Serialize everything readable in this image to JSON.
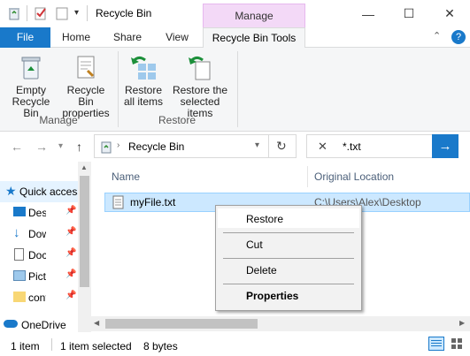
{
  "window": {
    "title": "Recycle Bin",
    "context_tab": "Manage",
    "controls": {
      "minimize": "—",
      "maximize": "☐",
      "close": "✕"
    }
  },
  "ribbon_tabs": {
    "file": "File",
    "home": "Home",
    "share": "Share",
    "view": "View",
    "tools": "Recycle Bin Tools"
  },
  "ribbon": {
    "manage": {
      "label": "Manage",
      "empty_line1": "Empty",
      "empty_line2": "Recycle Bin",
      "props_line1": "Recycle Bin",
      "props_line2": "properties"
    },
    "restore": {
      "label": "Restore",
      "all_line1": "Restore",
      "all_line2": "all items",
      "sel_line1": "Restore the",
      "sel_line2": "selected items"
    }
  },
  "address": {
    "path": "Recycle Bin",
    "search_value": "*.txt"
  },
  "nav_pane": {
    "items": [
      {
        "label": "Quick access",
        "icon": "star-icon"
      },
      {
        "label": "Desktop",
        "icon": "desktop-icon"
      },
      {
        "label": "Downloads",
        "icon": "download-icon"
      },
      {
        "label": "Documents",
        "icon": "document-icon"
      },
      {
        "label": "Pictures",
        "icon": "picture-icon"
      },
      {
        "label": "content",
        "icon": "folder-icon"
      },
      {
        "label": "OneDrive",
        "icon": "cloud-icon"
      }
    ]
  },
  "columns": {
    "name": "Name",
    "location": "Original Location"
  },
  "files": [
    {
      "name": "myFile.txt",
      "location": "C:\\Users\\Alex\\Desktop"
    }
  ],
  "context_menu": {
    "restore": "Restore",
    "cut": "Cut",
    "delete": "Delete",
    "properties": "Properties"
  },
  "status": {
    "count": "1 item",
    "selected": "1 item selected",
    "size": "8 bytes"
  },
  "colors": {
    "accent": "#1979ca",
    "selection": "#cce8ff",
    "manage_tab": "#f3d9f7"
  }
}
